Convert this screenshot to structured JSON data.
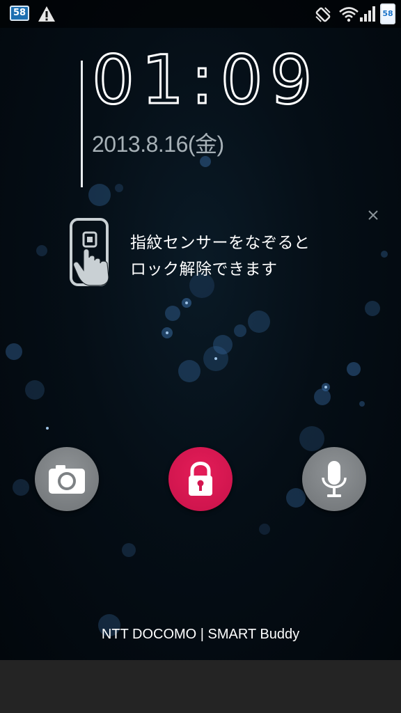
{
  "status_bar": {
    "notification_badge": "58",
    "warning_icon": "warning-icon",
    "vibrate_icon": "vibrate-icon",
    "wifi_icon": "wifi-icon",
    "signal_icon": "signal-icon",
    "battery_level": "58"
  },
  "clock": {
    "time": "01:09",
    "date": "2013.8.16(金)"
  },
  "hint": {
    "line1": "指紋センサーをなぞると",
    "line2": "ロック解除できます",
    "close_icon": "close-icon",
    "fingerprint_icon": "fingerprint-swipe-icon"
  },
  "actions": {
    "camera_icon": "camera-icon",
    "lock_icon": "lock-icon",
    "mic_icon": "microphone-icon",
    "lock_color": "#d4154f",
    "side_button_color": "#7d8184"
  },
  "carrier": "NTT DOCOMO | SMART Buddy"
}
